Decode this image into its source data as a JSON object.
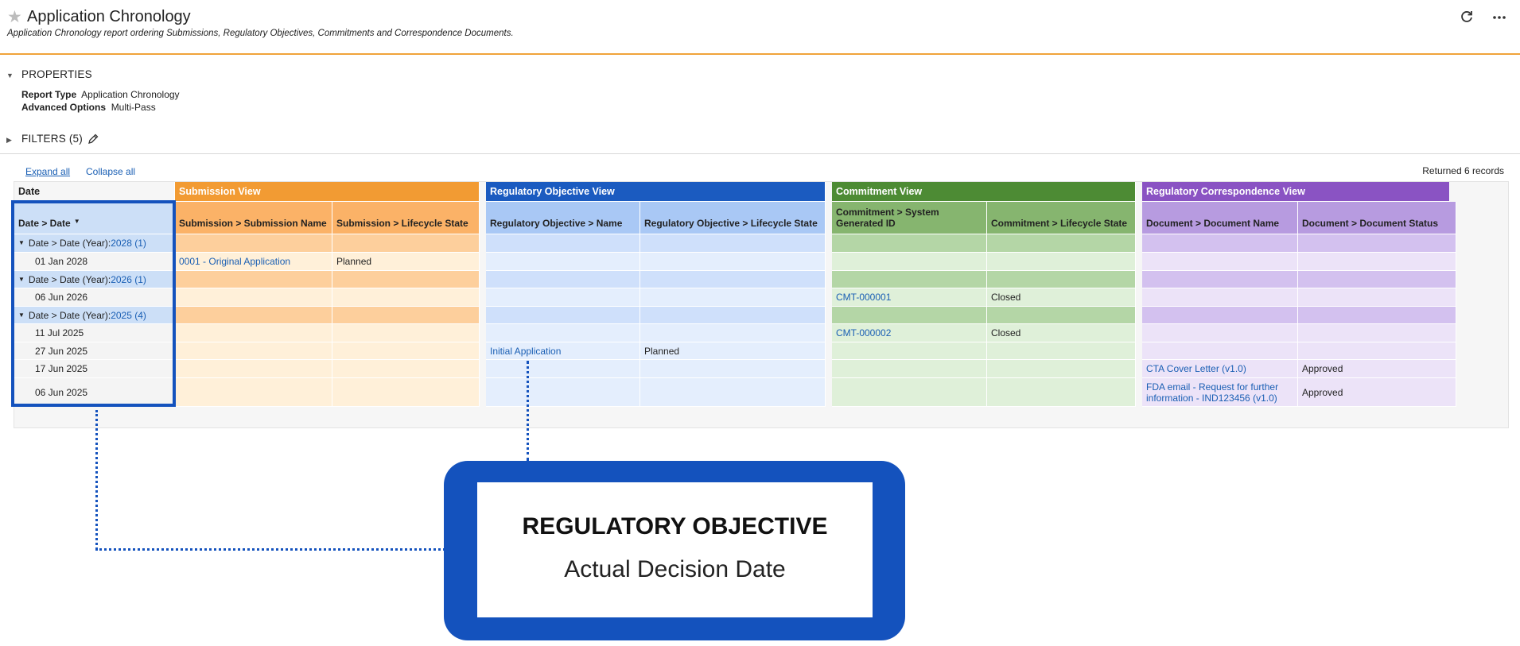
{
  "header": {
    "title": "Application Chronology",
    "subtitle": "Application Chronology report ordering Submissions, Regulatory Objectives, Commitments and Correspondence Documents.",
    "star_icon": "star-icon",
    "refresh_icon": "refresh-icon",
    "more_icon": "more-icon"
  },
  "properties": {
    "title": "PROPERTIES",
    "report_type_label": "Report Type",
    "report_type_value": "Application Chronology",
    "advanced_label": "Advanced Options",
    "advanced_value": "Multi-Pass"
  },
  "filters": {
    "title": "FILTERS (5)",
    "edit_icon": "pencil-icon"
  },
  "toolbar": {
    "expand_all": "Expand all",
    "collapse_all": "Collapse all",
    "returned": "Returned 6 records"
  },
  "colors": {
    "submission_header": "#f29b33",
    "submission_col": "#fbb267",
    "submission_group": "#fdcf9c",
    "submission_row": "#fff0d9",
    "objective_header": "#1b5bc0",
    "objective_col": "#a9c8f5",
    "objective_group": "#cfe0fb",
    "objective_row": "#e4eefd",
    "commitment_header": "#4d8b34",
    "commitment_col": "#86b56f",
    "commitment_group": "#b4d6a6",
    "commitment_row": "#dff0d9",
    "correspondence_header": "#8a53c3",
    "correspondence_col": "#b79be0",
    "correspondence_group": "#d3c1ef",
    "correspondence_row": "#ece3f8",
    "date_col": "#ccdff7",
    "date_row": "#f4f4f4"
  },
  "table": {
    "groups": [
      "Date",
      "Submission View",
      "Regulatory Objective View",
      "Commitment View",
      "Regulatory Correspondence View"
    ],
    "columns": [
      "Date > Date",
      "Submission > Submission Name",
      "Submission > Lifecycle State",
      "Regulatory Objective > Name",
      "Regulatory Objective > Lifecycle State",
      "Commitment > System Generated ID",
      "Commitment > Lifecycle State",
      "Document > Document Name",
      "Document > Document Status"
    ],
    "rows": [
      {
        "type": "group",
        "prefix": "Date > Date (Year): ",
        "year": "2028 (1)"
      },
      {
        "type": "data",
        "date": "01 Jan 2028",
        "sub_name": "0001 - Original Application",
        "sub_state": "Planned",
        "obj_name": "",
        "obj_state": "",
        "cmt_id": "",
        "cmt_state": "",
        "doc_name": "",
        "doc_status": ""
      },
      {
        "type": "group",
        "prefix": "Date > Date (Year): ",
        "year": "2026 (1)"
      },
      {
        "type": "data",
        "date": "06 Jun 2026",
        "sub_name": "",
        "sub_state": "",
        "obj_name": "",
        "obj_state": "",
        "cmt_id": "CMT-000001",
        "cmt_state": "Closed",
        "doc_name": "",
        "doc_status": ""
      },
      {
        "type": "group",
        "prefix": "Date > Date (Year): ",
        "year": "2025 (4)"
      },
      {
        "type": "data",
        "date": "11 Jul 2025",
        "sub_name": "",
        "sub_state": "",
        "obj_name": "",
        "obj_state": "",
        "cmt_id": "CMT-000002",
        "cmt_state": "Closed",
        "doc_name": "",
        "doc_status": ""
      },
      {
        "type": "data",
        "date": "27 Jun 2025",
        "sub_name": "",
        "sub_state": "",
        "obj_name": "Initial Application",
        "obj_state": "Planned",
        "cmt_id": "",
        "cmt_state": "",
        "doc_name": "",
        "doc_status": ""
      },
      {
        "type": "data",
        "date": "17 Jun 2025",
        "sub_name": "",
        "sub_state": "",
        "obj_name": "",
        "obj_state": "",
        "cmt_id": "",
        "cmt_state": "",
        "doc_name": "CTA Cover Letter (v1.0)",
        "doc_status": "Approved"
      },
      {
        "type": "data",
        "date": "06 Jun 2025",
        "sub_name": "",
        "sub_state": "",
        "obj_name": "",
        "obj_state": "",
        "cmt_id": "",
        "cmt_state": "",
        "doc_name": "FDA email - Request for further information - IND123456 (v1.0)",
        "doc_status": "Approved"
      }
    ]
  },
  "callout": {
    "title": "REGULATORY OBJECTIVE",
    "subtitle": "Actual Decision Date"
  }
}
